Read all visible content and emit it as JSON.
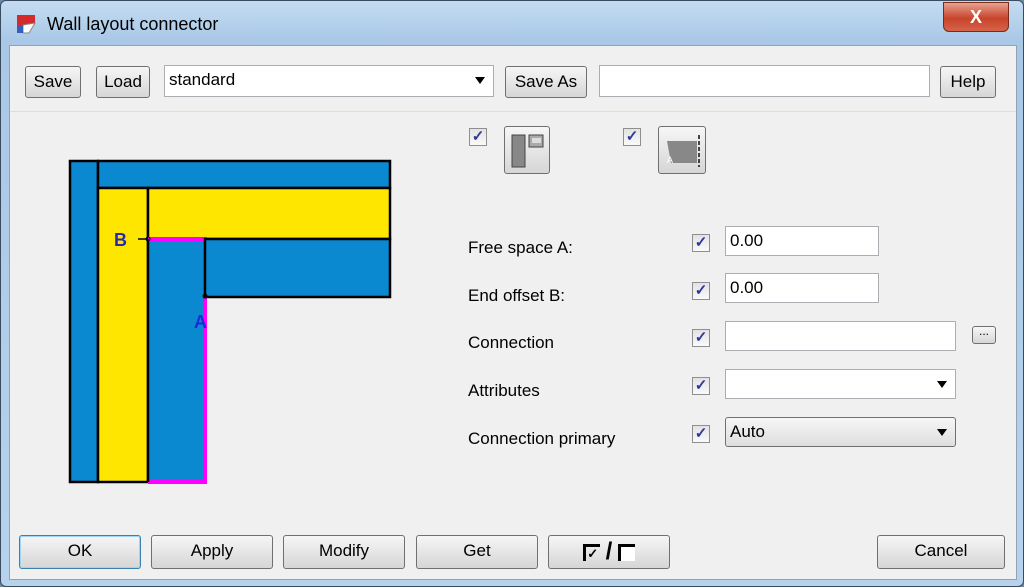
{
  "window": {
    "title": "Wall layout connector",
    "close_label": "X"
  },
  "toolbar": {
    "save": "Save",
    "load": "Load",
    "preset": "standard",
    "save_as": "Save As",
    "save_as_name": "",
    "help": "Help"
  },
  "diagram": {
    "label_a": "A",
    "label_b": "B",
    "colors": {
      "wall": "#0a88d0",
      "layer": "#ffe600",
      "highlight": "#ff00ff"
    }
  },
  "options": {
    "icon1": "primary-wall-layout-icon",
    "icon2": "wall-end-cut-icon",
    "icon1_checked": true,
    "icon2_checked": true
  },
  "form": [
    {
      "label": "Free space  A:",
      "checked": true,
      "value": "0.00",
      "type": "text"
    },
    {
      "label": "End offset  B:",
      "checked": true,
      "value": "0.00",
      "type": "text"
    },
    {
      "label": "Connection",
      "checked": true,
      "value": "",
      "type": "text-browse",
      "browse": "..."
    },
    {
      "label": "Attributes",
      "checked": true,
      "value": "",
      "type": "select"
    },
    {
      "label": "Connection primary",
      "checked": true,
      "value": "Auto",
      "type": "select"
    }
  ],
  "footer": {
    "ok": "OK",
    "apply": "Apply",
    "modify": "Modify",
    "get": "Get",
    "toggle_slash": "/",
    "cancel": "Cancel"
  }
}
